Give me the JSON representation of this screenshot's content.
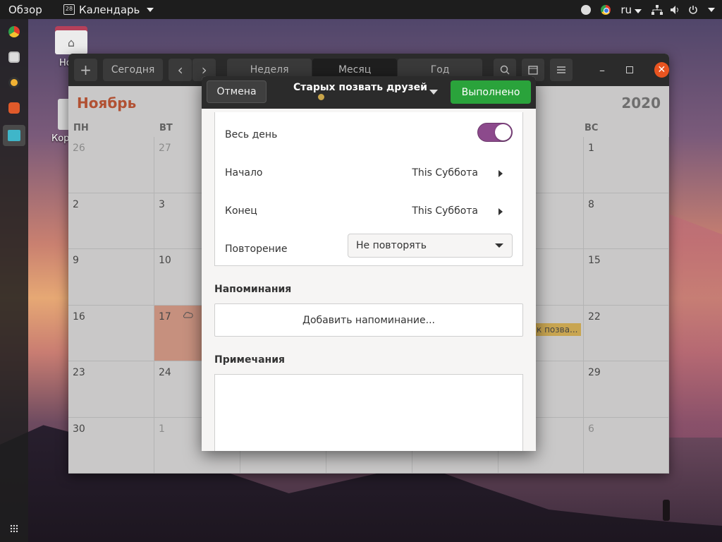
{
  "topbar": {
    "activities": "Обзор",
    "app_icon_text": "28",
    "app_name": "Календарь",
    "language": "ru"
  },
  "desktop": {
    "home_label": "Но",
    "trash_label": "Кор"
  },
  "calendar": {
    "toolbar": {
      "today": "Сегодня",
      "prev": "‹",
      "next": "›",
      "view_week": "Неделя",
      "view_month": "Месяц",
      "view_year": "Год",
      "add": "+"
    },
    "month": "Ноябрь",
    "year": "2020",
    "weekdays": [
      "ПН",
      "ВТ",
      "",
      "",
      "",
      "",
      "ВС"
    ],
    "rows": [
      [
        "26",
        "27",
        "",
        "",
        "",
        "",
        "1"
      ],
      [
        "2",
        "3",
        "",
        "",
        "",
        "",
        "8"
      ],
      [
        "9",
        "10",
        "",
        "",
        "",
        "",
        "15"
      ],
      [
        "16",
        "17",
        "",
        "",
        "",
        "",
        "22"
      ],
      [
        "23",
        "24",
        "",
        "",
        "",
        "",
        "29"
      ],
      [
        "30",
        "1",
        "",
        "",
        "",
        "",
        "6"
      ]
    ],
    "event_chip": "к позва..."
  },
  "dialog": {
    "cancel": "Отмена",
    "title": "Старых позвать друзей",
    "done": "Выполнено",
    "all_day_label": "Весь день",
    "all_day_on": true,
    "start_label": "Начало",
    "start_value": "This Суббота",
    "end_label": "Конец",
    "end_value": "This Суббота",
    "repeat_label": "Повторение",
    "repeat_value": "Не повторять",
    "reminders_header": "Напоминания",
    "add_reminder": "Добавить напоминание...",
    "notes_header": "Примечания",
    "notes_value": ""
  },
  "colors": {
    "accent_today": "#f2b09a",
    "month_title": "#d8633f",
    "done_button": "#2aa33b",
    "switch_on": "#8c4a8c",
    "event_dot": "#c9a54a"
  }
}
